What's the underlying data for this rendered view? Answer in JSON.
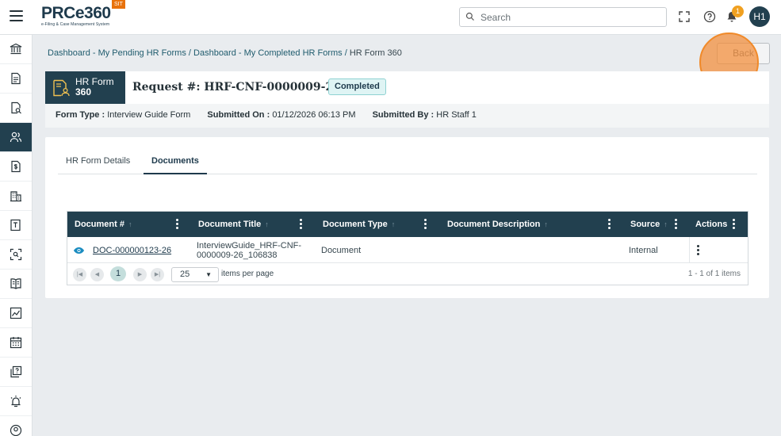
{
  "app": {
    "logo_text": "PRCe360",
    "logo_subtitle": "e-Filing & Case Management System",
    "env_badge": "SIT"
  },
  "topbar": {
    "search_placeholder": "Search",
    "notification_count": "1",
    "user_initials": "H1"
  },
  "sidebar": {
    "items": [
      {
        "name": "sidebar-item-institution",
        "icon": "bank-icon",
        "active": false
      },
      {
        "name": "sidebar-item-documents",
        "icon": "document-icon",
        "active": false
      },
      {
        "name": "sidebar-item-search-docs",
        "icon": "document-search-icon",
        "active": false
      },
      {
        "name": "sidebar-item-hr",
        "icon": "users-icon",
        "active": true
      },
      {
        "name": "sidebar-item-billing",
        "icon": "dollar-document-icon",
        "active": false
      },
      {
        "name": "sidebar-item-organizations",
        "icon": "building-icon",
        "active": false
      },
      {
        "name": "sidebar-item-templates",
        "icon": "template-icon",
        "active": false
      },
      {
        "name": "sidebar-item-scan",
        "icon": "scan-icon",
        "active": false
      },
      {
        "name": "sidebar-item-library",
        "icon": "book-icon",
        "active": false
      },
      {
        "name": "sidebar-item-reports",
        "icon": "chart-icon",
        "active": false
      },
      {
        "name": "sidebar-item-calendar",
        "icon": "calendar-icon",
        "active": false
      },
      {
        "name": "sidebar-item-help-docs",
        "icon": "question-copy-icon",
        "active": false
      },
      {
        "name": "sidebar-item-alerts",
        "icon": "alarm-icon",
        "active": false
      },
      {
        "name": "sidebar-item-profile",
        "icon": "user-circle-icon",
        "active": false
      }
    ]
  },
  "breadcrumb": {
    "link1": "Dashboard - My Pending HR Forms",
    "sep1": " / ",
    "link2": "Dashboard - My Completed HR Forms",
    "sep2": " / ",
    "current": "HR Form 360"
  },
  "back_label": "Back",
  "header": {
    "chip_line1": "HR Form",
    "chip_line2": "360",
    "request_prefix": "Request #: ",
    "request_id": "HRF-CNF-0000009-26",
    "status": "Completed",
    "meta": {
      "form_type_label": "Form Type :",
      "form_type_value": "Interview Guide Form",
      "submitted_on_label": "Submitted On :",
      "submitted_on_value": "01/12/2026 06:13 PM",
      "submitted_by_label": "Submitted By :",
      "submitted_by_value": "HR Staff 1"
    }
  },
  "tabs": [
    {
      "label": "HR Form Details",
      "active": false
    },
    {
      "label": "Documents",
      "active": true
    }
  ],
  "grid": {
    "columns": [
      "Document #",
      "Document Title",
      "Document Type",
      "Document Description",
      "Source",
      "Actions"
    ],
    "rows": [
      {
        "doc_number": "DOC-000000123-26",
        "title": "InterviewGuide_HRF-CNF-0000009-26_106838",
        "type": "Document",
        "description": "",
        "source": "Internal"
      }
    ],
    "pager": {
      "current_page": "1",
      "page_size": "25",
      "items_per_page_label": "items per page",
      "info": "1 - 1 of 1 items"
    }
  },
  "colors": {
    "primary": "#22404f",
    "link": "#1f5b6d",
    "notification": "#f0a020",
    "env_badge": "#e8720c",
    "status_bg": "#dff4f4"
  }
}
